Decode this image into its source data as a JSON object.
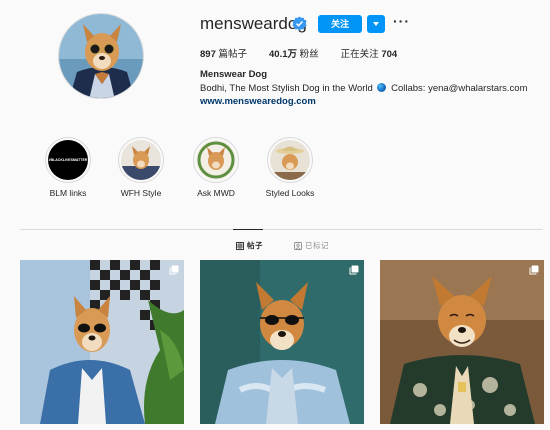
{
  "profile": {
    "username": "mensweardog",
    "follow_label": "关注",
    "stats": {
      "posts_count": "897",
      "posts_label": "篇帖子",
      "followers_count": "40.1万",
      "followers_label": "粉丝",
      "following_label": "正在关注",
      "following_count": "704"
    },
    "full_name": "Menswear Dog",
    "bio_text": "Bodhi, The Most Stylish Dog in the World",
    "bio_collab": "Collabs: yena@whalarstars.com",
    "website": "www.menswearedog.com"
  },
  "highlights": [
    {
      "label": "BLM links",
      "cover_text": "#BLACKLIVESMATTER"
    },
    {
      "label": "WFH Style"
    },
    {
      "label": "Ask MWD"
    },
    {
      "label": "Styled Looks"
    }
  ],
  "tabs": {
    "posts": "帖子",
    "tagged": "已标记"
  },
  "colors": {
    "accent": "#0095f6",
    "link": "#00376b",
    "text": "#262626",
    "muted": "#8e8e8e",
    "border": "#dbdbdb"
  },
  "icons": [
    "verified-badge-icon",
    "chevron-down-icon",
    "more-options-icon",
    "globe-emoji-icon",
    "grid-icon",
    "tag-icon",
    "multi-post-icon"
  ]
}
